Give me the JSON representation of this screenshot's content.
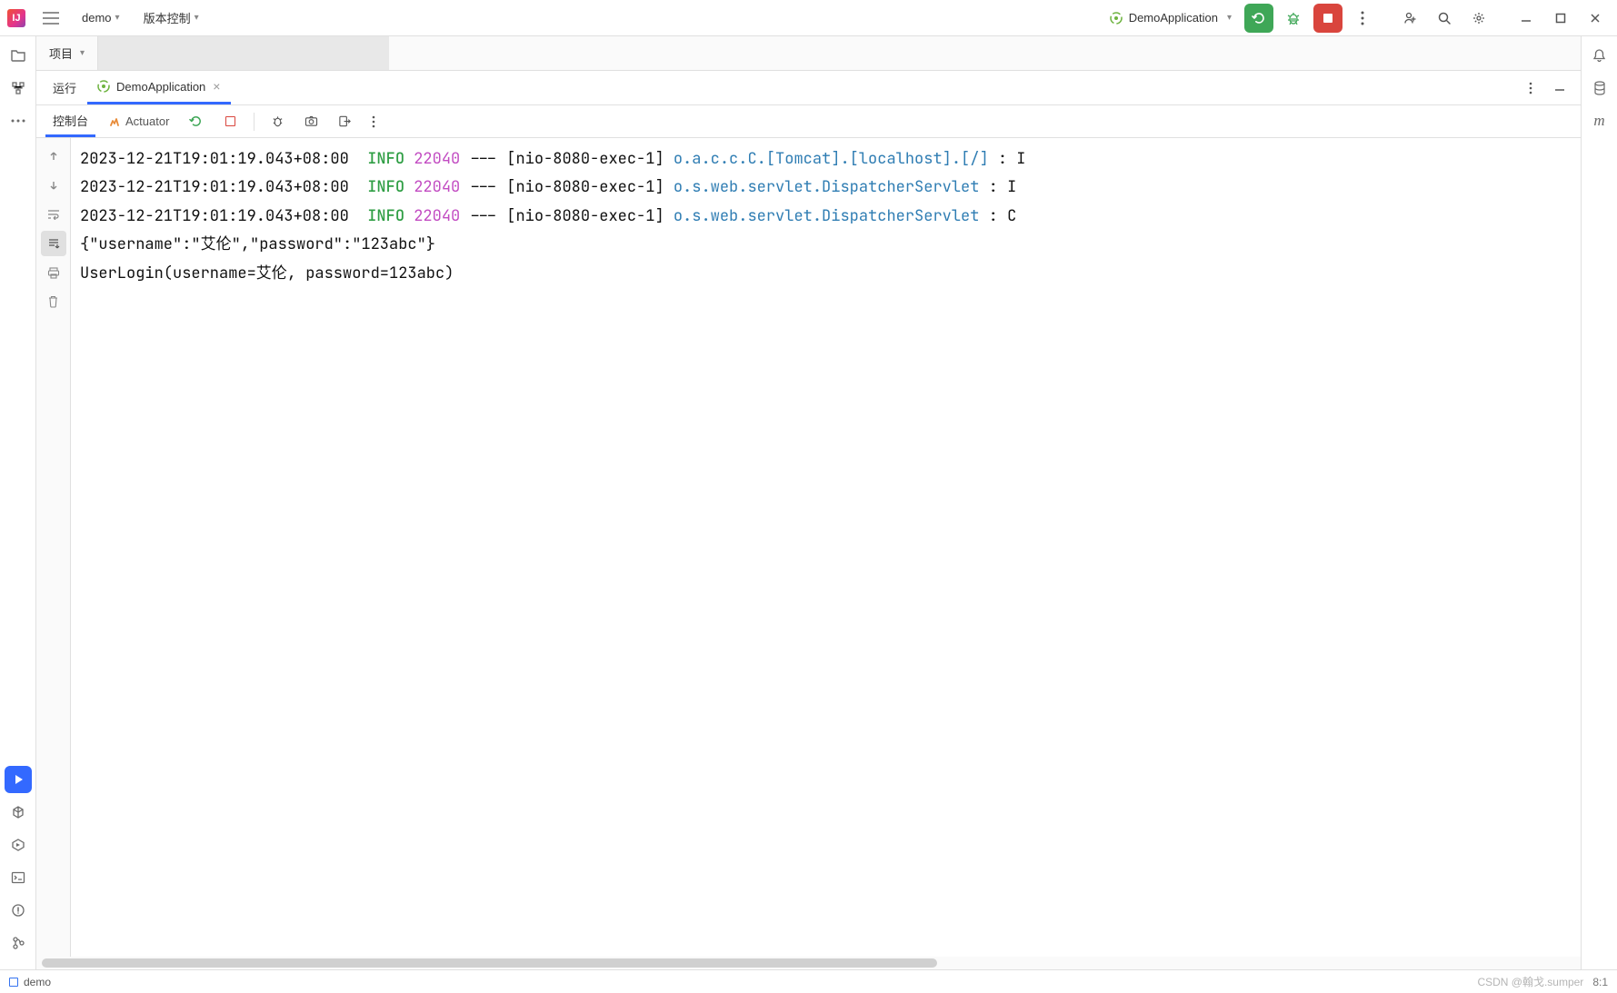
{
  "titlebar": {
    "project_name": "demo",
    "vcs_label": "版本控制",
    "run_config": "DemoApplication"
  },
  "project_panel": {
    "title": "项目"
  },
  "run_panel": {
    "label": "运行",
    "tab_name": "DemoApplication"
  },
  "console_bar": {
    "console_tab": "控制台",
    "actuator_tab": "Actuator"
  },
  "log_lines": [
    {
      "ts": "2023-12-21T19:01:19.043+08:00",
      "level": "INFO",
      "pid": "22040",
      "thread": "[nio-8080-exec-1]",
      "cls": "o.a.c.c.C.[Tomcat].[localhost].[/]",
      "tail": ": I"
    },
    {
      "ts": "2023-12-21T19:01:19.043+08:00",
      "level": "INFO",
      "pid": "22040",
      "thread": "[nio-8080-exec-1]",
      "cls": "o.s.web.servlet.DispatcherServlet",
      "tail": ": I"
    },
    {
      "ts": "2023-12-21T19:01:19.043+08:00",
      "level": "INFO",
      "pid": "22040",
      "thread": "[nio-8080-exec-1]",
      "cls": "o.s.web.servlet.DispatcherServlet",
      "tail": ": C"
    }
  ],
  "plain_lines": [
    "{\"username\":\"艾伦\",\"password\":\"123abc\"}",
    "UserLogin(username=艾伦, password=123abc)"
  ],
  "statusbar": {
    "module": "demo",
    "pos": "8:1",
    "watermark": "CSDN @翰戈.sumper"
  }
}
